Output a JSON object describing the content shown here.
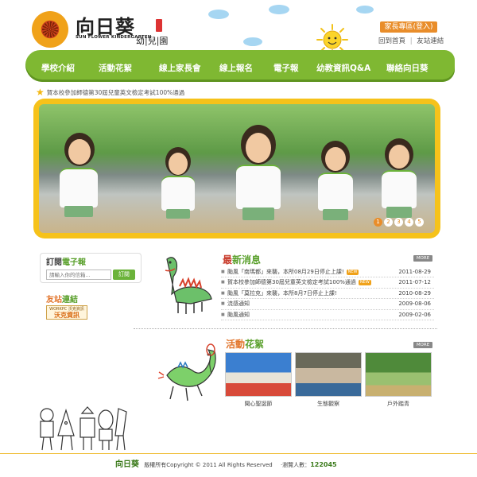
{
  "header": {
    "logo_title": "向日葵",
    "logo_en": "SUN FLOWER KINDERGARTEN",
    "logo_sub": "幼|兒|園",
    "login_label": "家長專區(登入)",
    "home_link": "回到首頁",
    "friends_link": "友站連結",
    "separator": "|"
  },
  "nav": {
    "items": [
      "學校介紹",
      "活動花絮",
      "線上家長會",
      "線上報名",
      "電子報",
      "幼教資訊Q&A",
      "聯絡向日葵"
    ]
  },
  "ticker": {
    "text": "賀本校參加師德第30屆兒童英文檢定考試100%通過"
  },
  "banner": {
    "pages": [
      "1",
      "2",
      "3",
      "4",
      "5"
    ],
    "active_page": 1
  },
  "epaper": {
    "title_a": "訂閱",
    "title_b": "電子報",
    "input_placeholder": "請輸入你的信箱...",
    "button_label": "訂閱"
  },
  "friends": {
    "title_a": "友站",
    "title_b": "連結",
    "logo_top": "WORKPC 沃克資訊",
    "logo_main": "沃克資訊"
  },
  "news": {
    "title_first": "最",
    "title_rest": "新消息",
    "more_label": "MORE",
    "items": [
      {
        "text": "颱風「南瑪都」來襲，本所08月29日停止上課!",
        "date": "2011-08-29",
        "is_new": true,
        "badge": "NEW"
      },
      {
        "text": "賀本校參加師德第30屆兒童英文檢定考試100%通過",
        "date": "2011-07-12",
        "is_new": true,
        "badge": "NEW"
      },
      {
        "text": "颱風「莫拉克」來襲，本所8月7日停止上課!",
        "date": "2010-08-29",
        "is_new": false,
        "badge": ""
      },
      {
        "text": "流感通知",
        "date": "2009-08-06",
        "is_new": false,
        "badge": ""
      },
      {
        "text": "颱風通知",
        "date": "2009-02-06",
        "is_new": false,
        "badge": ""
      }
    ]
  },
  "activities": {
    "title_a": "活動",
    "title_b": "花絮",
    "more_label": "MORE",
    "items": [
      {
        "caption": "聞心聖誕節",
        "colors": [
          "#3b7fd0",
          "#e8e4d8",
          "#d84a3a"
        ]
      },
      {
        "caption": "生態觀察",
        "colors": [
          "#6a6a5a",
          "#c9b8a0",
          "#3a6a9a"
        ]
      },
      {
        "caption": "戶外踏青",
        "colors": [
          "#4f8a3a",
          "#9ac070",
          "#c8b070"
        ]
      }
    ]
  },
  "footer": {
    "brand": "向日葵",
    "copyright": "版權所有Copyright © 2011  All Rights Reserved",
    "visitors_label": "‧瀏覽人數：",
    "visitors_count": "122045"
  },
  "colors": {
    "nav_green": "#7fb832",
    "banner_yellow": "#f6c21a",
    "accent_orange": "#e98d2a"
  }
}
